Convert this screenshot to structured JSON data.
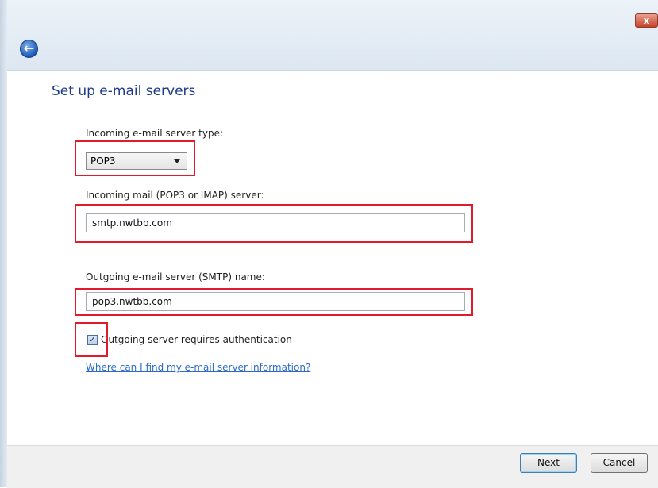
{
  "window": {
    "close_label": "x",
    "back_glyph": "←"
  },
  "page": {
    "title": "Set up e-mail servers"
  },
  "incoming_type": {
    "label": "Incoming e-mail server type:",
    "value": "POP3"
  },
  "incoming_server": {
    "label": "Incoming mail (POP3 or IMAP) server:",
    "value": "smtp.nwtbb.com"
  },
  "outgoing_server": {
    "label": "Outgoing e-mail server (SMTP) name:",
    "value": "pop3.nwtbb.com"
  },
  "auth": {
    "label": "Outgoing server requires authentication",
    "checked": true,
    "check_glyph": "✓"
  },
  "help_link": {
    "text": "Where can I find my e-mail server information?"
  },
  "buttons": {
    "next": "Next",
    "cancel": "Cancel"
  },
  "colors": {
    "highlight": "#e11b2b",
    "title": "#1e3a8a",
    "link": "#2d6ac8"
  },
  "icons": {
    "back": "back-arrow-icon",
    "close": "close-icon",
    "dropdown": "chevron-down-icon",
    "checkbox": "checkmark-icon"
  }
}
